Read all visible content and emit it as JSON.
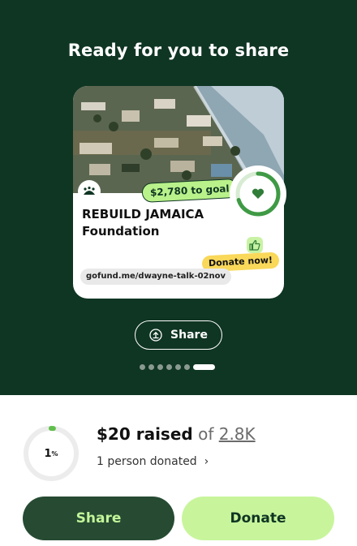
{
  "header": {
    "title": "Ready for you to share"
  },
  "card": {
    "goal_pill": "$2,780 to goal",
    "name_line1": "REBUILD JAMAICA",
    "name_line2": "Foundation",
    "donate_pill": "Donate now!",
    "url": "gofund.me/dwayne-talk-02nov",
    "photo_icon": "aerial-flood-photo",
    "logo_icon": "gofundme-logo-icon",
    "heart_icon": "heart-icon",
    "thumb_icon": "thumbs-up-icon"
  },
  "share_outline": {
    "label": "Share",
    "icon": "share-upload-icon"
  },
  "carousel": {
    "count": 7,
    "active_index": 6
  },
  "summary": {
    "percent": "1",
    "percent_sign": "%",
    "progress_fraction": 0.01,
    "raised_amount": "$20 raised",
    "raised_of": "of",
    "goal": "2.8K",
    "donors": "1 person donated",
    "chevron_icon": "chevron-right-icon"
  },
  "buttons": {
    "share": "Share",
    "donate": "Donate"
  },
  "colors": {
    "dark_green": "#0f3523",
    "lime": "#c8f59c",
    "ring_green": "#3f9a45",
    "yellow": "#f9d85a"
  }
}
